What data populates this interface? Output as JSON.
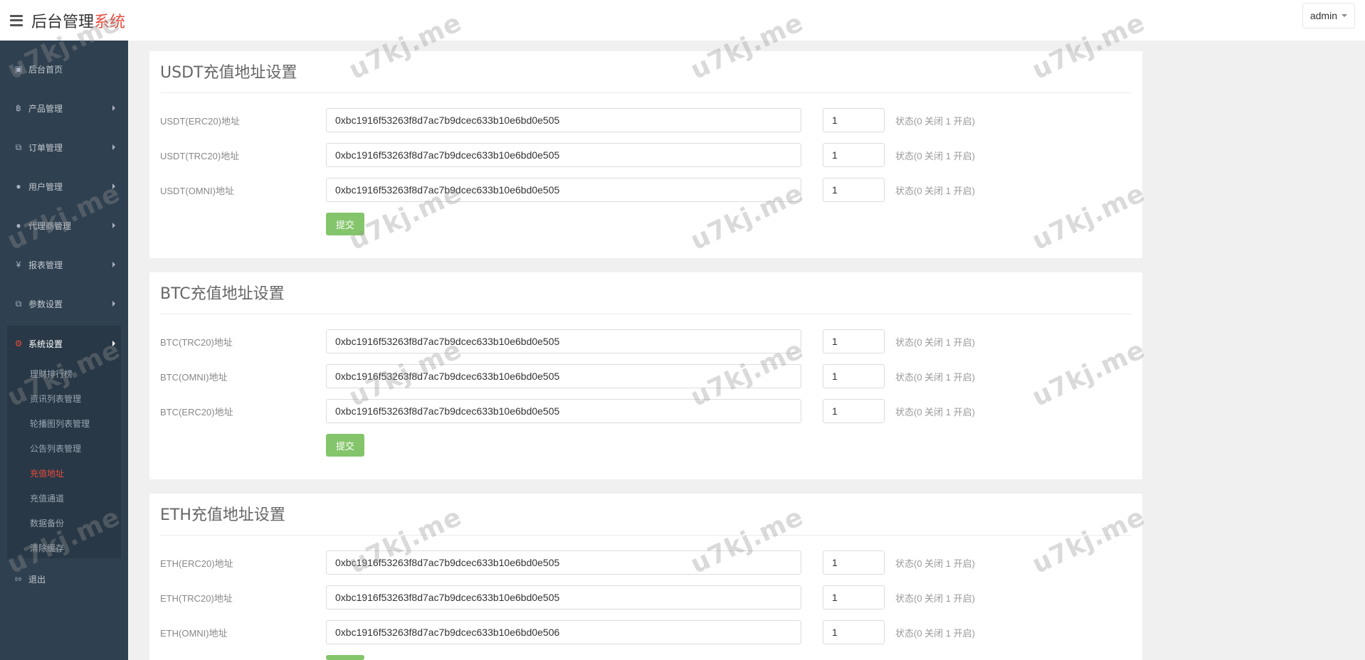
{
  "header": {
    "logo_main": "后台管理",
    "logo_accent": "系统",
    "user": "admin"
  },
  "sidebar": {
    "items": [
      {
        "label": "后台首页",
        "icon": "dashboard-icon"
      },
      {
        "label": "产品管理",
        "icon": "bitcoin-icon"
      },
      {
        "label": "订单管理",
        "icon": "copy-icon"
      },
      {
        "label": "用户管理",
        "icon": "user-icon"
      },
      {
        "label": "代理商管理",
        "icon": "users-icon"
      },
      {
        "label": "报表管理",
        "icon": "yen-icon"
      },
      {
        "label": "参数设置",
        "icon": "copy-icon"
      }
    ],
    "active_group": {
      "label": "系统设置",
      "icon": "gears-icon",
      "sub": [
        {
          "label": "理财排行榜"
        },
        {
          "label": "资讯列表管理"
        },
        {
          "label": "轮播图列表管理"
        },
        {
          "label": "公告列表管理"
        },
        {
          "label": "充值地址"
        },
        {
          "label": "充值通道"
        },
        {
          "label": "数据备份"
        },
        {
          "label": "清除缓存"
        }
      ]
    },
    "logout": {
      "label": "退出",
      "icon": "sign-out-icon"
    }
  },
  "sections": [
    {
      "title": "USDT充值地址设置",
      "rows": [
        {
          "label": "USDT(ERC20)地址",
          "address": "0xbc1916f53263f8d7ac7b9dcec633b10e6bd0e505",
          "status": "1",
          "hint": "状态(0 关闭 1 开启)"
        },
        {
          "label": "USDT(TRC20)地址",
          "address": "0xbc1916f53263f8d7ac7b9dcec633b10e6bd0e505",
          "status": "1",
          "hint": "状态(0 关闭 1 开启)"
        },
        {
          "label": "USDT(OMNI)地址",
          "address": "0xbc1916f53263f8d7ac7b9dcec633b10e6bd0e505",
          "status": "1",
          "hint": "状态(0 关闭 1 开启)"
        }
      ],
      "submit": "提交"
    },
    {
      "title": "BTC充值地址设置",
      "rows": [
        {
          "label": "BTC(TRC20)地址",
          "address": "0xbc1916f53263f8d7ac7b9dcec633b10e6bd0e505",
          "status": "1",
          "hint": "状态(0 关闭 1 开启)"
        },
        {
          "label": "BTC(OMNI)地址",
          "address": "0xbc1916f53263f8d7ac7b9dcec633b10e6bd0e505",
          "status": "1",
          "hint": "状态(0 关闭 1 开启)"
        },
        {
          "label": "BTC(ERC20)地址",
          "address": "0xbc1916f53263f8d7ac7b9dcec633b10e6bd0e505",
          "status": "1",
          "hint": "状态(0 关闭 1 开启)"
        }
      ],
      "submit": "提交"
    },
    {
      "title": "ETH充值地址设置",
      "rows": [
        {
          "label": "ETH(ERC20)地址",
          "address": "0xbc1916f53263f8d7ac7b9dcec633b10e6bd0e505",
          "status": "1",
          "hint": "状态(0 关闭 1 开启)"
        },
        {
          "label": "ETH(TRC20)地址",
          "address": "0xbc1916f53263f8d7ac7b9dcec633b10e6bd0e505",
          "status": "1",
          "hint": "状态(0 关闭 1 开启)"
        },
        {
          "label": "ETH(OMNI)地址",
          "address": "0xbc1916f53263f8d7ac7b9dcec633b10e6bd0e506",
          "status": "1",
          "hint": "状态(0 关闭 1 开启)"
        }
      ]
    }
  ],
  "watermark": "u7kj.me",
  "colors": {
    "sidebar_bg": "#2f4050",
    "accent_red": "#e74c3c",
    "submit_green": "#84c56b"
  }
}
